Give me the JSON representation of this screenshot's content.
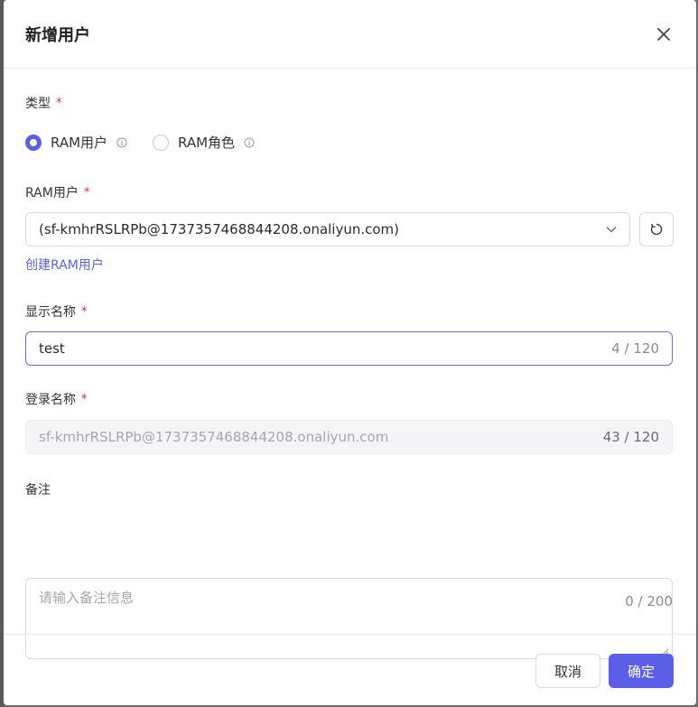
{
  "dialog": {
    "title": "新增用户"
  },
  "type_field": {
    "label": "类型",
    "required_mark": "*",
    "options": [
      {
        "label": "RAM用户",
        "selected": true
      },
      {
        "label": "RAM角色",
        "selected": false
      }
    ]
  },
  "ram_user_field": {
    "label": "RAM用户",
    "required_mark": "*",
    "selected_value": "(sf-kmhrRSLRPb@1737357468844208.onaliyun.com)",
    "create_link": "创建RAM用户"
  },
  "display_name_field": {
    "label": "显示名称",
    "required_mark": "*",
    "value": "test",
    "count": "4 / 120"
  },
  "login_name_field": {
    "label": "登录名称",
    "required_mark": "*",
    "value": "sf-kmhrRSLRPb@1737357468844208.onaliyun.com",
    "count": "43 / 120"
  },
  "remark_field": {
    "label": "备注",
    "placeholder": "请输入备注信息",
    "count": "0 / 200"
  },
  "footer": {
    "cancel_label": "取消",
    "ok_label": "确定"
  },
  "colors": {
    "accent": "#5b5fe8",
    "required": "#f5222d"
  }
}
